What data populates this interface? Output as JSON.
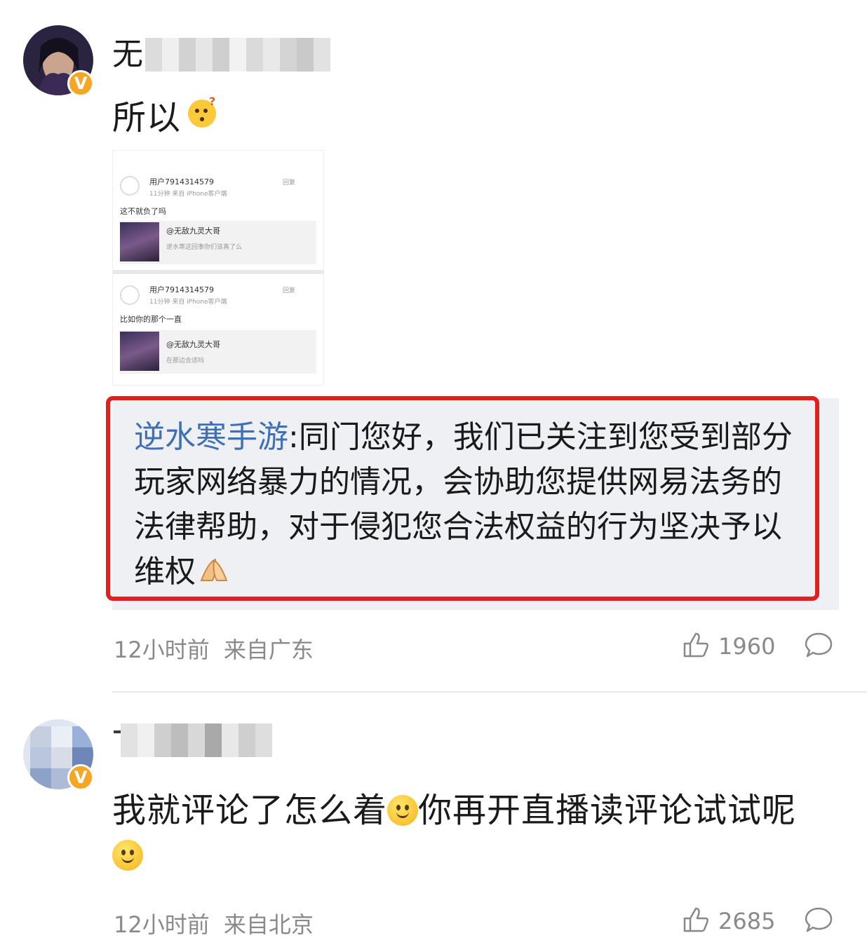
{
  "comment1": {
    "name_visible": "无",
    "text": "所以",
    "emoji": "thinking-face-emoji",
    "screenshot": {
      "post1": {
        "user": "用户7914314579",
        "meta": "11分钟 来自 iPhone客户端",
        "follow": "回复",
        "text": "这不就负了吗",
        "quote_user": "@无敌九灵大哥",
        "quote_text": "逆水寒这回事你们该真了么"
      },
      "post2": {
        "user": "用户7914314579",
        "meta": "11分钟 来自 iPhone客户端",
        "follow": "回复",
        "text": "比如你的那个一直",
        "quote_user": "@无敌九灵大哥",
        "quote_text": "在那边合适吗"
      }
    },
    "reply": {
      "author": "逆水寒手游",
      "text": ":同门您好，我们已关注到您受到部分玩家网络暴力的情况，会协助您提供网易法务的法律帮助，对于侵犯您合法权益的行为坚决予以维权"
    },
    "time": "12小时前",
    "location": "来自广东",
    "likes": "1960"
  },
  "comment2": {
    "text_part1": "我就评论了怎么着",
    "text_part2": "你再开直播读评论试试呢",
    "time": "12小时前",
    "location": "来自北京",
    "likes": "2685"
  },
  "colors": {
    "highlight_border": "#e0201f",
    "reply_author": "#3f6fb4",
    "verified_badge": "#f6a623"
  }
}
